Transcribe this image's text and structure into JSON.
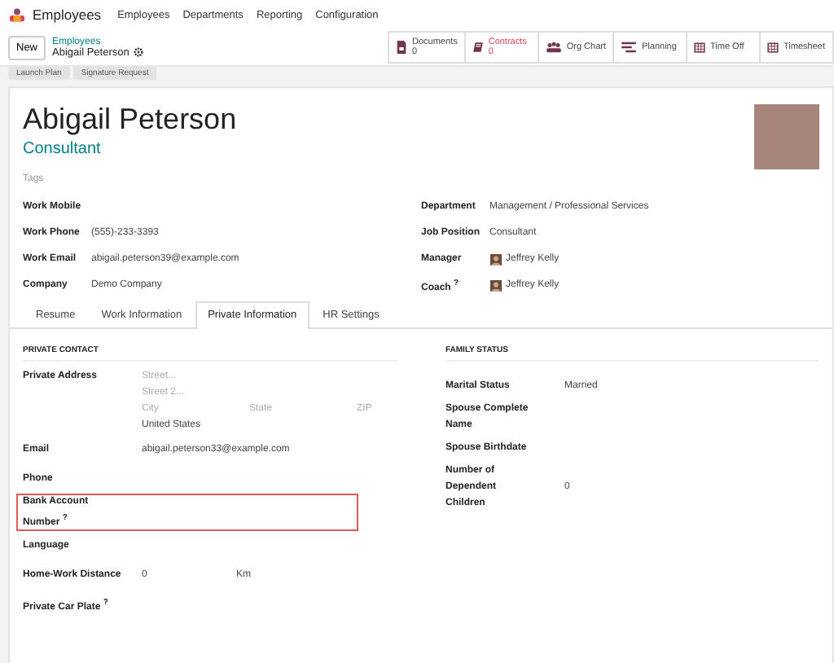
{
  "app": {
    "name": "Employees",
    "menu": [
      "Employees",
      "Departments",
      "Reporting",
      "Configuration"
    ]
  },
  "control": {
    "new_button": "New",
    "breadcrumb": "Employees",
    "record": "Abigail Peterson"
  },
  "smart_buttons": [
    {
      "kind": "documents",
      "label": "Documents",
      "count": "0",
      "alert": false
    },
    {
      "kind": "contracts",
      "label": "Contracts",
      "count": "0",
      "alert": true
    },
    {
      "kind": "org",
      "label": "Org Chart",
      "alert": false
    },
    {
      "kind": "planning",
      "label": "Planning",
      "alert": false
    },
    {
      "kind": "calendar",
      "label": "Time Off",
      "alert": false
    },
    {
      "kind": "calendar",
      "label": "Timesheet",
      "alert": false
    }
  ],
  "actions": [
    "Launch Plan",
    "Signature Request"
  ],
  "employee": {
    "name": "Abigail Peterson",
    "job_title": "Consultant",
    "tags_placeholder": "Tags"
  },
  "left_fields": [
    {
      "label": "Work Mobile"
    },
    {
      "label": "Work Phone",
      "value": "(555)-233-3393"
    },
    {
      "label": "Work Email",
      "value": "abigail.peterson39@example.com"
    },
    {
      "label": "Company",
      "value": "Demo Company"
    }
  ],
  "right_fields": [
    {
      "label": "Department",
      "value": "Management / Professional Services",
      "kind": "text"
    },
    {
      "label": "Job Position",
      "value": "Consultant",
      "kind": "text"
    },
    {
      "label": "Manager",
      "value": "Jeffrey Kelly",
      "kind": "person"
    },
    {
      "label": "Coach $^{?}$",
      "value": "Jeffrey Kelly",
      "kind": "person"
    }
  ],
  "tabs": [
    {
      "label": "Resume",
      "selected": false
    },
    {
      "label": "Work Information",
      "selected": false
    },
    {
      "label": "Private Information",
      "selected": true
    },
    {
      "label": "HR Settings",
      "selected": false
    }
  ],
  "private_contact": {
    "title": "PRIVATE CONTACT",
    "address_label": "Private Address",
    "street": "Street...",
    "street2": "Street 2...",
    "city": "City",
    "state": "State",
    "zip": "ZIP",
    "country": "United States",
    "fields": [
      {
        "label": "Email",
        "value": "abigail.peterson33@example.com",
        "highlighted": false
      },
      {
        "label": "Phone",
        "highlighted": false
      },
      {
        "label": "Bank Account Number $^{?}$",
        "highlighted": true
      },
      {
        "label": "Language",
        "highlighted": false
      },
      {
        "label": "Home-Work Distance",
        "value": "0",
        "unit": "Km",
        "highlighted": false
      },
      {
        "label": "Private Car Plate $^{?}$",
        "highlighted": false
      }
    ]
  },
  "family_status": {
    "title": "FAMILY STATUS",
    "fields": [
      {
        "label": "Marital Status",
        "value": "Married"
      },
      {
        "label": "Spouse Complete Name"
      },
      {
        "label": "Spouse Birthdate"
      },
      {
        "label": "Number of Dependent Children",
        "value": "0"
      }
    ]
  }
}
